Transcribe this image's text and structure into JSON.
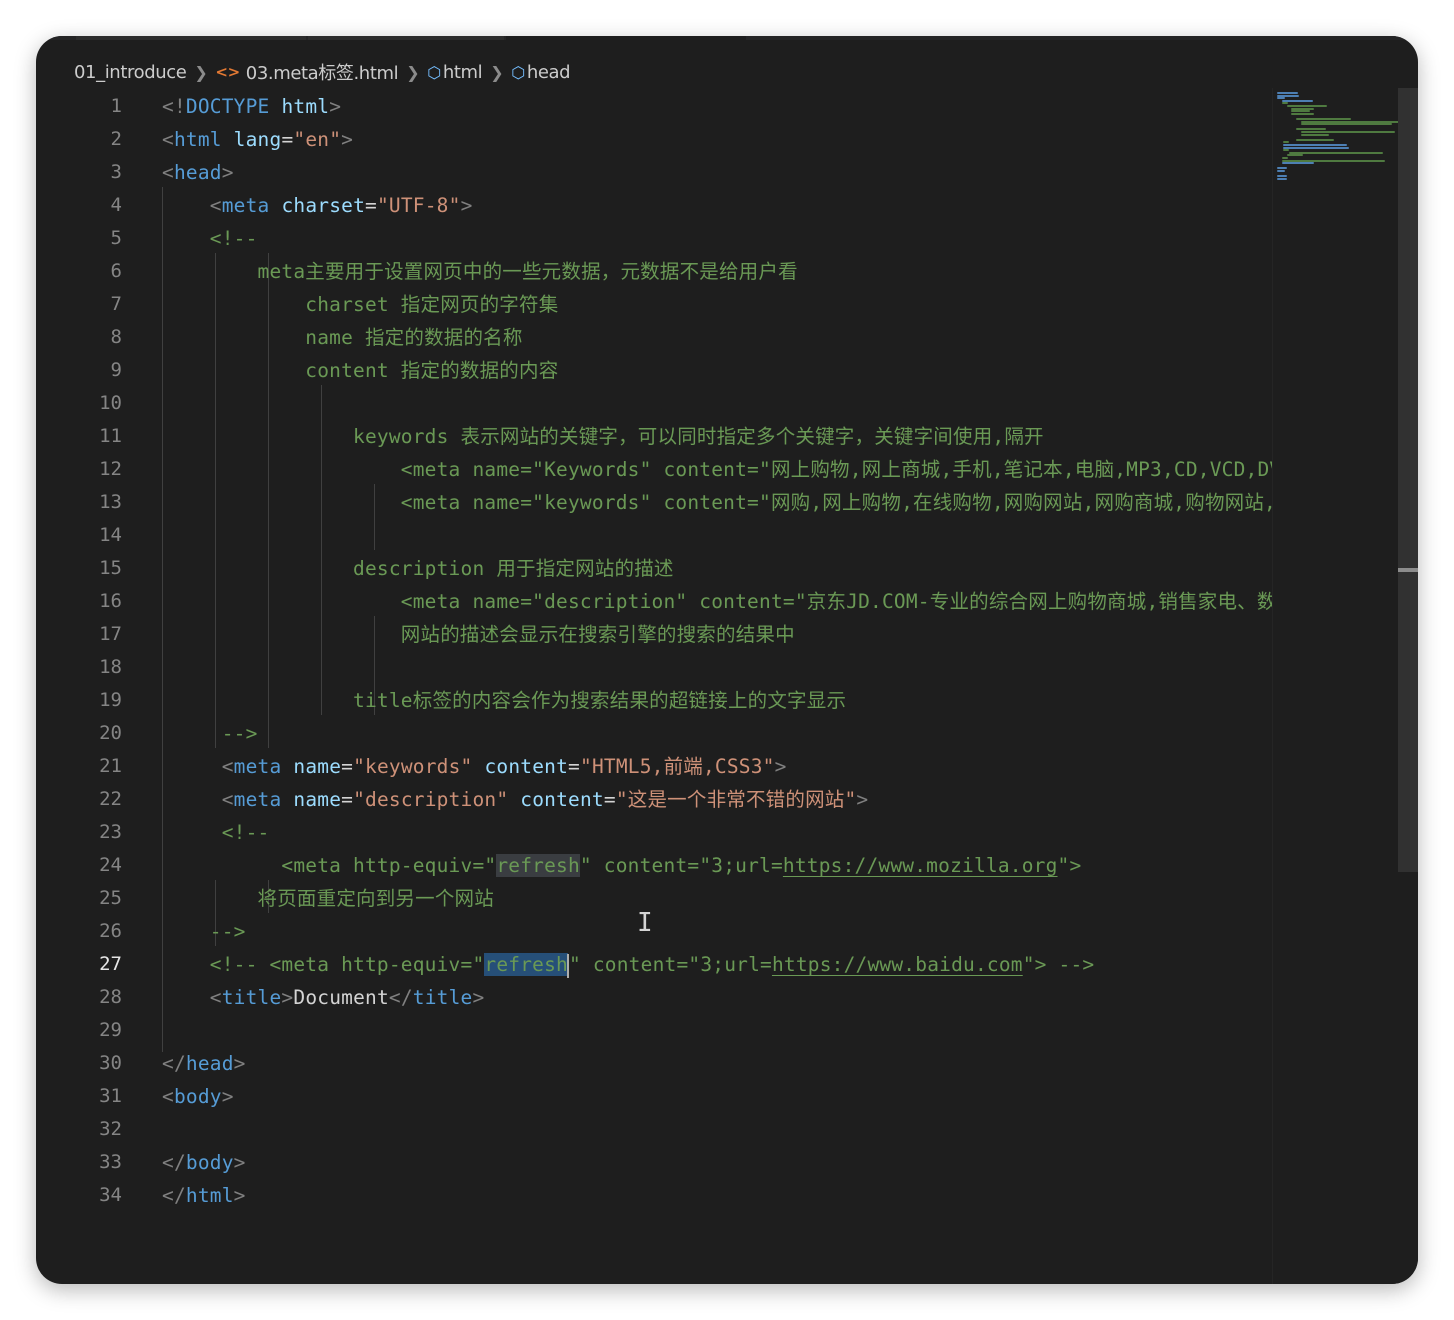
{
  "breadcrumb": {
    "folder": "01_introduce",
    "file": "03.meta标签.html",
    "symbol1": "html",
    "symbol2": "head"
  },
  "editor": {
    "active_line": 27,
    "lines": [
      {
        "n": "1",
        "html": "<span class=\"br\">&lt;!</span><span class=\"tg\">DOCTYPE</span> <span class=\"at\">html</span><span class=\"br\">&gt;</span>"
      },
      {
        "n": "2",
        "html": "<span class=\"br\">&lt;</span><span class=\"tg\">html</span> <span class=\"at\">lang</span><span class=\"tx\">=</span><span class=\"st\">\"en\"</span><span class=\"br\">&gt;</span>"
      },
      {
        "n": "3",
        "html": "<span class=\"br\">&lt;</span><span class=\"tg\">head</span><span class=\"br\">&gt;</span>"
      },
      {
        "n": "4",
        "html": "    <span class=\"br\">&lt;</span><span class=\"tg\">meta</span> <span class=\"at\">charset</span><span class=\"tx\">=</span><span class=\"st\">\"UTF-8\"</span><span class=\"br\">&gt;</span>"
      },
      {
        "n": "5",
        "html": "    <span class=\"c\">&lt;!--</span>"
      },
      {
        "n": "6",
        "html": "<span class=\"c\">        meta主要用于设置网页中的一些元数据，元数据不是给用户看</span>"
      },
      {
        "n": "7",
        "html": "<span class=\"c\">            charset 指定网页的字符集</span>"
      },
      {
        "n": "8",
        "html": "<span class=\"c\">            name 指定的数据的名称</span>"
      },
      {
        "n": "9",
        "html": "<span class=\"c\">            content 指定的数据的内容</span>"
      },
      {
        "n": "10",
        "html": ""
      },
      {
        "n": "11",
        "html": "<span class=\"c\">                keywords 表示网站的关键字，可以同时指定多个关键字，关键字间使用,隔开</span>"
      },
      {
        "n": "12",
        "html": "<span class=\"c\">                    &lt;meta name=\"Keywords\" content=\"网上购物,网上商城,手机,笔记本,电脑,MP3,CD,VCD,DV,相机,数码,配件,手表,存储卡,京东\"/&gt;</span>"
      },
      {
        "n": "13",
        "html": "<span class=\"c\">                    &lt;meta name=\"keywords\" content=\"网购,网上购物,在线购物,网购网站,网购商城,购物网站,网购中心\"&gt;</span>"
      },
      {
        "n": "14",
        "html": ""
      },
      {
        "n": "15",
        "html": "<span class=\"c\">                description 用于指定网站的描述</span>"
      },
      {
        "n": "16",
        "html": "<span class=\"c\">                    &lt;meta name=\"description\" content=\"京东JD.COM-专业的综合网上购物商城,销售家电、数码通讯\"/&gt;</span>"
      },
      {
        "n": "17",
        "html": "<span class=\"c\">                    网站的描述会显示在搜索引擎的搜索的结果中</span>"
      },
      {
        "n": "18",
        "html": ""
      },
      {
        "n": "19",
        "html": "<span class=\"c\">                title标签的内容会作为搜索结果的超链接上的文字显示</span>"
      },
      {
        "n": "20",
        "html": "<span class=\"c\">     --&gt;</span>"
      },
      {
        "n": "21",
        "html": "     <span class=\"br\">&lt;</span><span class=\"tg\">meta</span> <span class=\"at\">name</span><span class=\"tx\">=</span><span class=\"st\">\"keywords\"</span> <span class=\"at\">content</span><span class=\"tx\">=</span><span class=\"st\">\"HTML5,前端,CSS3\"</span><span class=\"br\">&gt;</span>"
      },
      {
        "n": "22",
        "html": "     <span class=\"br\">&lt;</span><span class=\"tg\">meta</span> <span class=\"at\">name</span><span class=\"tx\">=</span><span class=\"st\">\"description\"</span> <span class=\"at\">content</span><span class=\"tx\">=</span><span class=\"st\">\"这是一个非常不错的网站\"</span><span class=\"br\">&gt;</span>"
      },
      {
        "n": "23",
        "html": "     <span class=\"c\">&lt;!--</span>"
      },
      {
        "n": "24",
        "html": "<span class=\"c\">          &lt;meta http-equiv=\"<span class=\"hl\">refresh</span>\" content=\"3;url=<span class=\"u\">https://www.mozilla.org</span>\"&gt;</span>"
      },
      {
        "n": "25",
        "html": "<span class=\"c\">        将页面重定向到另一个网站</span>"
      },
      {
        "n": "26",
        "html": "<span class=\"c\">    --&gt;</span>"
      },
      {
        "n": "27",
        "html": "<span class=\"c\">    &lt;!-- &lt;meta http-equiv=\"<span class=\"hl-sel\">refresh</span><span class=\"cursor\"></span>\" content=\"3;url=<span class=\"u\">https://www.baidu.com</span>\"&gt; --&gt;</span>"
      },
      {
        "n": "28",
        "html": "    <span class=\"br\">&lt;</span><span class=\"tg\">title</span><span class=\"br\">&gt;</span><span class=\"tx\">Document</span><span class=\"br\">&lt;/</span><span class=\"tg\">title</span><span class=\"br\">&gt;</span>"
      },
      {
        "n": "29",
        "html": ""
      },
      {
        "n": "30",
        "html": "<span class=\"br\">&lt;/</span><span class=\"tg\">head</span><span class=\"br\">&gt;</span>"
      },
      {
        "n": "31",
        "html": "<span class=\"br\">&lt;</span><span class=\"tg\">body</span><span class=\"br\">&gt;</span>"
      },
      {
        "n": "32",
        "html": ""
      },
      {
        "n": "33",
        "html": "<span class=\"br\">&lt;/</span><span class=\"tg\">body</span><span class=\"br\">&gt;</span>"
      },
      {
        "n": "34",
        "html": "<span class=\"br\">&lt;/</span><span class=\"tg\">html</span><span class=\"br\">&gt;</span>"
      }
    ]
  },
  "colors": {
    "background": "#1e1e1e",
    "comment": "#6a9955",
    "tag": "#569cd6",
    "attribute": "#9cdcfe",
    "string": "#ce9178",
    "selection": "#264f78"
  }
}
